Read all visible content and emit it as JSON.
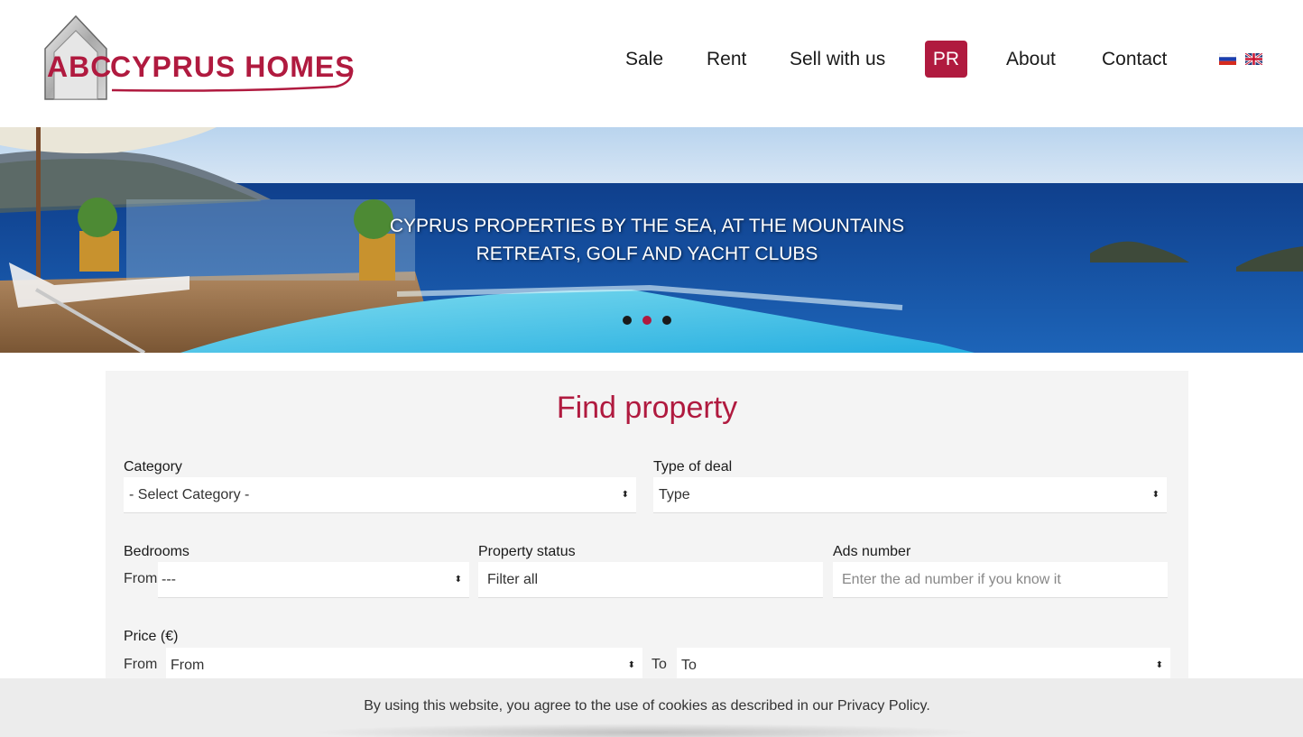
{
  "logo": {
    "text_abc": "ABC",
    "text_main": "CYPRUS HOMES"
  },
  "nav": {
    "items": [
      {
        "label": "Sale"
      },
      {
        "label": "Rent"
      },
      {
        "label": "Sell with us"
      },
      {
        "label": "PR"
      },
      {
        "label": "About"
      },
      {
        "label": "Contact"
      }
    ],
    "flags": [
      "ru-flag-icon",
      "uk-flag-icon"
    ]
  },
  "hero": {
    "line1": "CYPRUS PROPERTIES BY THE SEA, AT THE MOUNTAINS",
    "line2": "RETREATS, GOLF AND YACHT CLUBS",
    "active_slide": 2,
    "slide_count": 3
  },
  "search": {
    "title": "Find property",
    "category": {
      "label": "Category",
      "value": "- Select Category -"
    },
    "deal": {
      "label": "Type of deal",
      "value": "Type"
    },
    "bedrooms": {
      "label": "Bedrooms",
      "prefix": "From",
      "value": "---"
    },
    "status": {
      "label": "Property status",
      "value": "Filter all"
    },
    "ads": {
      "label": "Ads number",
      "placeholder": "Enter the ad number if you know it"
    },
    "price": {
      "label": "Price (€)",
      "from_prefix": "From",
      "from_value": "From",
      "to_prefix": "To",
      "to_value": "To"
    }
  },
  "cookie": {
    "text": "By using this website, you agree to the use of cookies as described in our Privacy Policy."
  },
  "colors": {
    "brand": "#b01a3f",
    "panel_bg": "#f4f4f4"
  }
}
